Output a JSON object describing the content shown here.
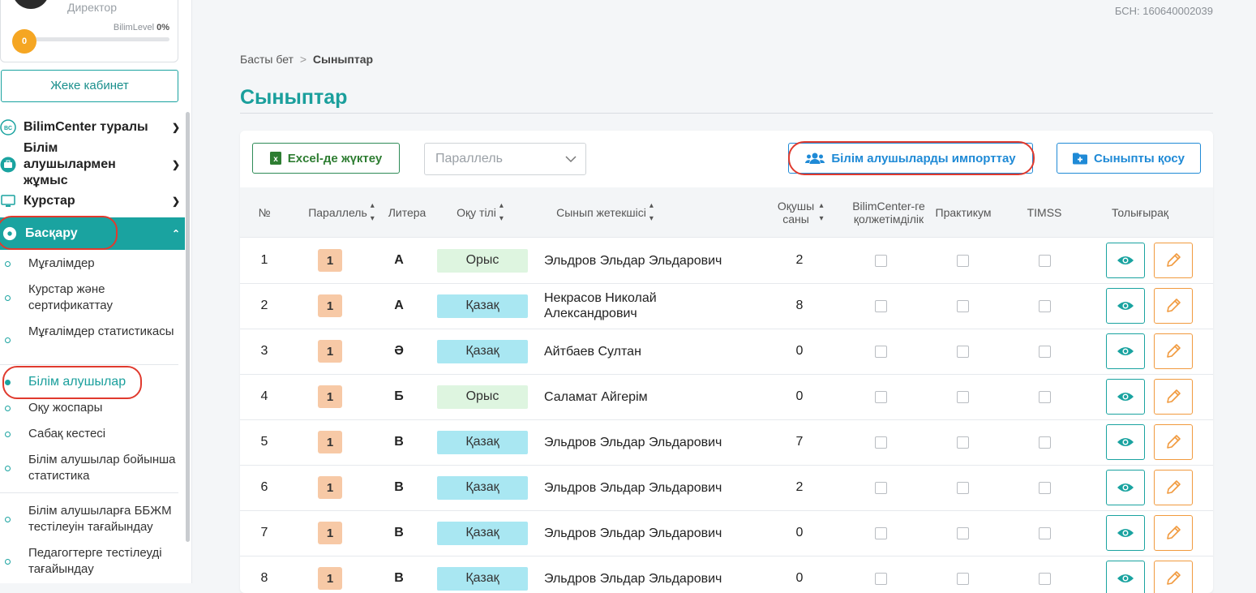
{
  "sidebar": {
    "role": "Директор",
    "level_label": "BilimLevel",
    "level_percent_text": "0%",
    "level_badge": "0",
    "level_progress_percent": 0,
    "cabinet_button": "Жеке кабинет",
    "menu": [
      {
        "label": "BilimCenter туралы",
        "icon": "bilimcenter-logo-icon"
      },
      {
        "label": "Білім алушылармен жұмыс",
        "icon": "briefcase-icon"
      },
      {
        "label": "Курстар",
        "icon": "monitor-icon"
      },
      {
        "label": "Басқару",
        "icon": "gear-icon"
      }
    ],
    "submenu": [
      "Мұғалімдер",
      "Курстар және сертификаттау",
      "Мұғалімдер статистикасы",
      "Білім алушылар",
      "Оқу жоспары",
      "Сабақ кестесі",
      "Білім алушылар бойынша статистика",
      "Білім алушыларға ББЖМ тестілеуін тағайындау",
      "Педагогтерге тестілеуді тағайындау"
    ]
  },
  "header": {
    "bsn": "БСН: 160640002039"
  },
  "breadcrumb": {
    "home": "Басты бет",
    "separator": ">",
    "current": "Сыныптар"
  },
  "page_title": "Сыныптар",
  "toolbar": {
    "excel_button": "Excel-де жүктеу",
    "parallel_placeholder": "Параллель",
    "import_button": "Білім алушыларды импорттау",
    "add_class_button": "Сыныпты қосу"
  },
  "table": {
    "headers": {
      "num": "№",
      "parallel": "Параллель",
      "letter": "Литера",
      "language": "Оқу тілі",
      "teacher": "Сынып жетекшісі",
      "students": "Оқушы саны",
      "bilimcenter": "BilimCenter-ге қолжетімділік",
      "practicum": "Практикум",
      "timss": "TIMSS",
      "details": "Толығырақ"
    },
    "rows": [
      {
        "num": "1",
        "parallel": "1",
        "letter": "А",
        "language": "Орыс",
        "lang_type": "ru",
        "teacher": "Эльдров Эльдар Эльдарович",
        "students": "2"
      },
      {
        "num": "2",
        "parallel": "1",
        "letter": "А",
        "language": "Қазақ",
        "lang_type": "kz",
        "teacher": "Некрасов Николай Александрович",
        "students": "8"
      },
      {
        "num": "3",
        "parallel": "1",
        "letter": "Ә",
        "language": "Қазақ",
        "lang_type": "kz",
        "teacher": "Айтбаев Султан",
        "students": "0"
      },
      {
        "num": "4",
        "parallel": "1",
        "letter": "Б",
        "language": "Орыс",
        "lang_type": "ru",
        "teacher": "Саламат Айгерім",
        "students": "0"
      },
      {
        "num": "5",
        "parallel": "1",
        "letter": "В",
        "language": "Қазақ",
        "lang_type": "kz",
        "teacher": "Эльдров Эльдар Эльдарович",
        "students": "7"
      },
      {
        "num": "6",
        "parallel": "1",
        "letter": "В",
        "language": "Қазақ",
        "lang_type": "kz",
        "teacher": "Эльдров Эльдар Эльдарович",
        "students": "2"
      },
      {
        "num": "7",
        "parallel": "1",
        "letter": "В",
        "language": "Қазақ",
        "lang_type": "kz",
        "teacher": "Эльдров Эльдар Эльдарович",
        "students": "0"
      },
      {
        "num": "8",
        "parallel": "1",
        "letter": "В",
        "language": "Қазақ",
        "lang_type": "kz",
        "teacher": "Эльдров Эльдар Эльдарович",
        "students": "0"
      }
    ]
  },
  "colors": {
    "accent": "#1aa3a0",
    "link_blue": "#1f8ad6",
    "excel_green": "#2e7d32",
    "edit_orange": "#f19a3e",
    "annotation_red": "#e03a2e"
  }
}
